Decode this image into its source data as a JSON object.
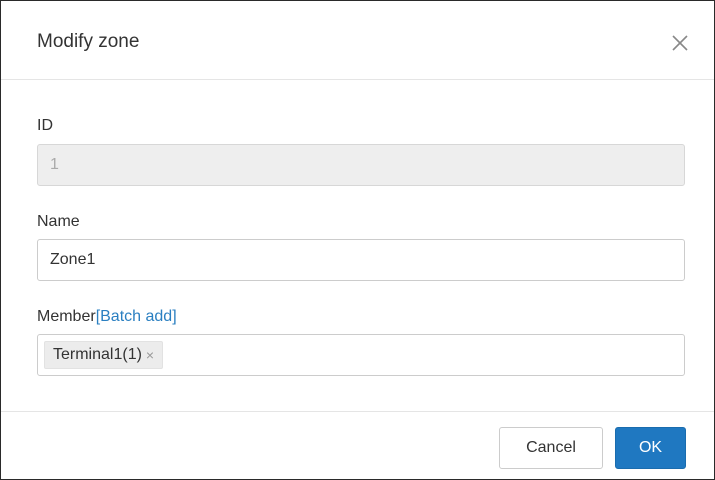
{
  "dialog": {
    "title": "Modify zone",
    "close_icon": "close-icon"
  },
  "form": {
    "id": {
      "label": "ID",
      "value": "1"
    },
    "name": {
      "label": "Name",
      "value": "Zone1"
    },
    "member": {
      "label": "Member",
      "batch_add": "[Batch add]",
      "tags": [
        {
          "label": "Terminal1(1)",
          "remove": "×"
        }
      ]
    }
  },
  "footer": {
    "cancel_label": "Cancel",
    "ok_label": "OK"
  },
  "colors": {
    "accent": "#1f78c1",
    "link": "#2a7fc1",
    "disabled_bg": "#eeeeee"
  }
}
